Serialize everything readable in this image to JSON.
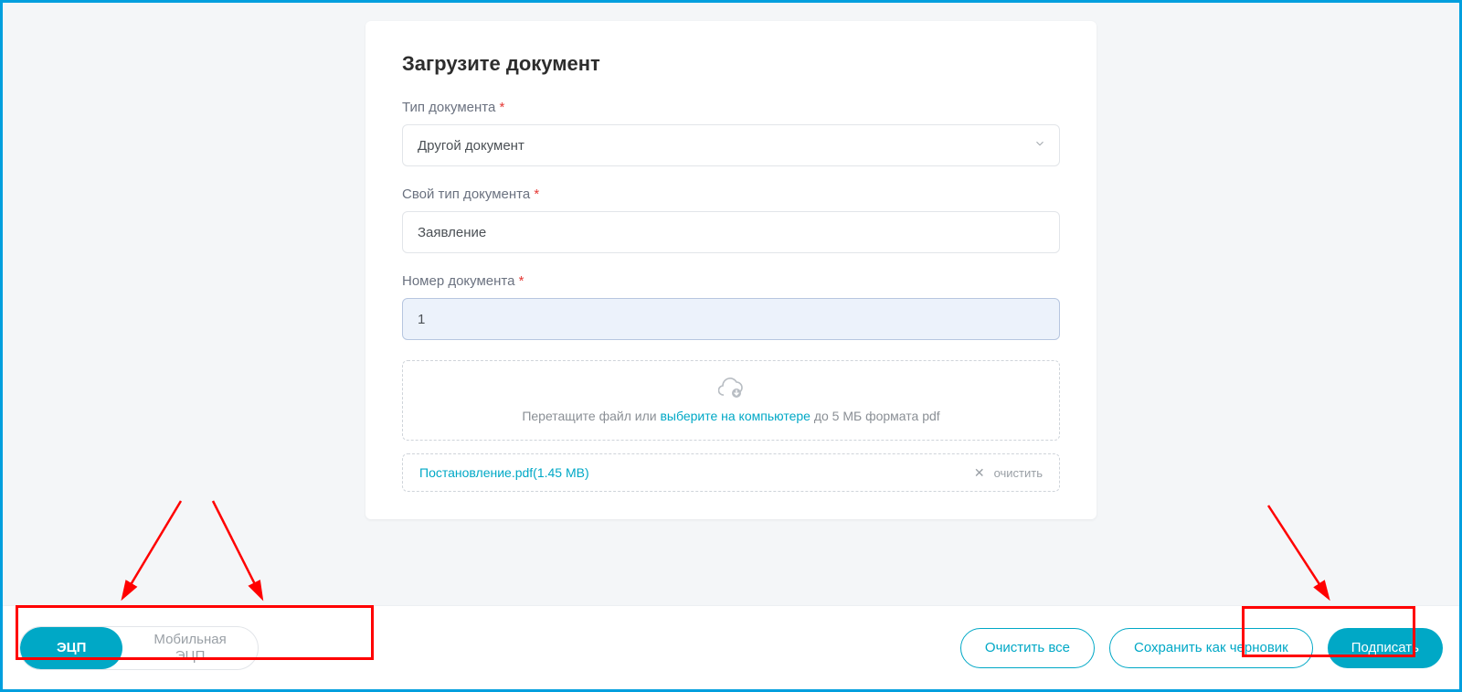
{
  "card": {
    "title": "Загрузите документ",
    "fields": {
      "doc_type": {
        "label": "Тип документа",
        "value": "Другой документ"
      },
      "own_type": {
        "label": "Свой тип документа",
        "value": "Заявление"
      },
      "doc_number": {
        "label": "Номер документа",
        "value": "1"
      }
    },
    "dropzone": {
      "text_before": "Перетащите файл или ",
      "link": "выберите на компьютере",
      "text_after": " до 5 МБ формата pdf"
    },
    "file": {
      "name": "Постановление.pdf(1.45 MB)",
      "clear": "очистить"
    }
  },
  "footer": {
    "seg_active": "ЭЦП",
    "seg_inactive": "Мобильная\nЭЦП",
    "clear_all": "Очистить все",
    "save_draft": "Сохранить как черновик",
    "sign": "Подписать"
  }
}
